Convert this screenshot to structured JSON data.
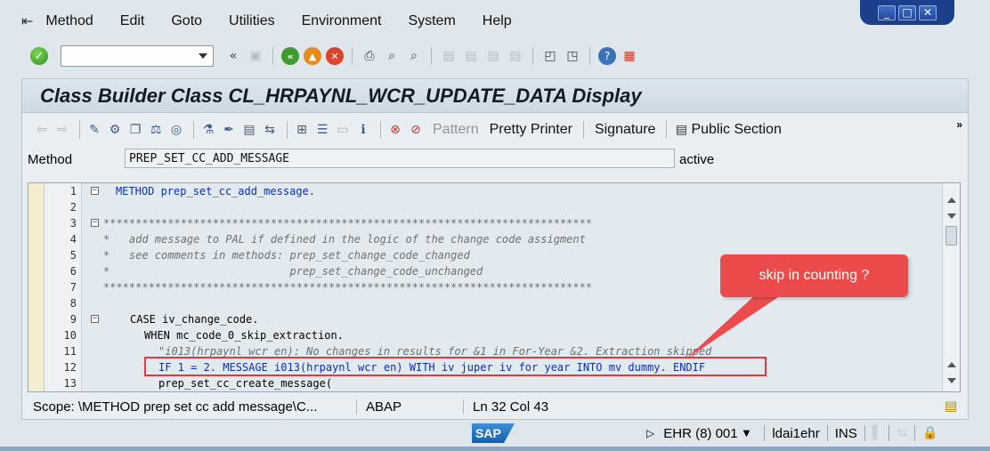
{
  "menu": {
    "items": [
      "Method",
      "Edit",
      "Goto",
      "Utilities",
      "Environment",
      "System",
      "Help"
    ]
  },
  "window_controls": {
    "minimize": "_",
    "maximize": "□",
    "close": "✕"
  },
  "standard_toolbar": {
    "command_field_value": "",
    "collapse_symbol": "«"
  },
  "title": "Class Builder Class CL_HRPAYNL_WCR_UPDATE_DATA Display",
  "app_toolbar": {
    "pattern": "Pattern",
    "pretty_printer": "Pretty Printer",
    "signature": "Signature",
    "public_section": "Public Section",
    "more": "»"
  },
  "method_row": {
    "label": "Method",
    "value": "PREP_SET_CC_ADD_MESSAGE",
    "state": "active"
  },
  "code_lines": [
    {
      "num": "1",
      "text": "METHOD prep_set_cc_add_message."
    },
    {
      "num": "2",
      "text": ""
    },
    {
      "num": "3",
      "text": "****************************************************************************"
    },
    {
      "num": "4",
      "text": "*   add message to PAL if defined in the logic of the change code assigment"
    },
    {
      "num": "5",
      "text": "*   see comments in methods: prep_set_change_code_changed"
    },
    {
      "num": "6",
      "text": "*                            prep_set_change_code_unchanged"
    },
    {
      "num": "7",
      "text": "****************************************************************************"
    },
    {
      "num": "8",
      "text": ""
    },
    {
      "num": "9",
      "text": "CASE iv_change_code."
    },
    {
      "num": "10",
      "text": "WHEN mc_code_0_skip_extraction."
    },
    {
      "num": "11",
      "text": "\"i013(hrpaynl wcr en): No changes in results for &1 in For-Year &2. Extraction skipped"
    },
    {
      "num": "12",
      "text": "IF 1 = 2. MESSAGE i013(hrpaynl wcr en) WITH iv juper iv for year INTO mv dummy. ENDIF"
    },
    {
      "num": "13",
      "text": "prep_set_cc_create_message("
    }
  ],
  "callout": {
    "text": "skip in counting ?",
    "color": "#ec4b4b"
  },
  "status": {
    "scope": "Scope: \\METHOD prep  set  cc  add  message\\C...",
    "language": "ABAP",
    "position": "Ln  32 Col  43"
  },
  "system_bar": {
    "logo": "SAP",
    "system": "EHR (8) 001",
    "server": "ldai1ehr",
    "mode": "INS"
  },
  "colors": {
    "keyword": "#0b2fb0",
    "comment": "#6f6f6f",
    "highlight": "#e03a3a"
  }
}
